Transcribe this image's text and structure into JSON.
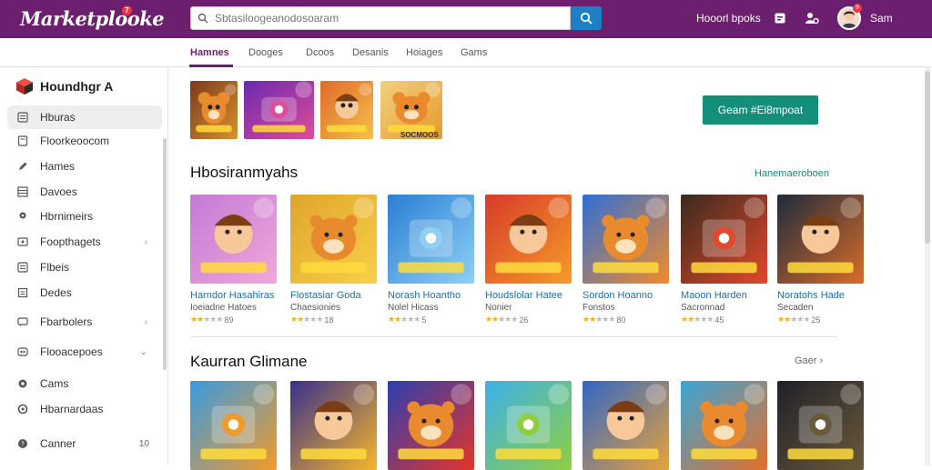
{
  "header": {
    "logo": "Marketplooke",
    "logo_badge": "7",
    "search_placeholder": "Sbtasiloogeanodosoaram",
    "link": "Hooorl bpoks",
    "avatar_badge": "9",
    "user_name": "Sam"
  },
  "tabs": [
    {
      "label": "Hamnes",
      "active": true
    },
    {
      "label": "Dooges"
    },
    {
      "label": "Dcoos"
    },
    {
      "label": "Desanis"
    },
    {
      "label": "Hoiages"
    },
    {
      "label": "Gams"
    }
  ],
  "sidebar": {
    "heading": "Houndhgr A",
    "items": [
      {
        "label": "Hburas",
        "icon": "list-icon",
        "active": true
      },
      {
        "label": "Floorkeoocom",
        "icon": "document-icon"
      },
      {
        "label": "Hames",
        "icon": "pencil-icon"
      },
      {
        "label": "Davoes",
        "icon": "grid-icon"
      },
      {
        "label": "Hbrnimeirs",
        "icon": "pin-icon"
      },
      {
        "label": "Foopthagets",
        "icon": "box-icon",
        "chevron": "›"
      },
      {
        "label": "Flbeis",
        "icon": "list-icon"
      },
      {
        "label": "Dedes",
        "icon": "folder-icon"
      },
      {
        "label": "Fbarbolers",
        "icon": "chat-icon",
        "chevron": "›"
      },
      {
        "label": "Flooacepoes",
        "icon": "group-icon",
        "chevron": "⌄"
      },
      {
        "label": "Cams",
        "icon": "settings-icon"
      },
      {
        "label": "Hbarnardaas",
        "icon": "gear-icon"
      },
      {
        "label": "Canner",
        "icon": "help-icon",
        "count": "10"
      }
    ]
  },
  "promo": {
    "label": "SOCMOOS",
    "cta": "Geam #Ei8mpoat"
  },
  "section1": {
    "title": "Hbosiranmyahs",
    "link": "Hanemaeroboen",
    "cards": [
      {
        "title": "Harndor Hasahiras",
        "sub": "Ioeiadne Hatoes",
        "rating": 2,
        "count": "89",
        "palette": [
          "#c27ad6",
          "#f2a7d8"
        ]
      },
      {
        "title": "Flostasiar Goda",
        "sub": "Chaesionies",
        "rating": 2,
        "count": "18",
        "palette": [
          "#e0a42b",
          "#f7d04a"
        ]
      },
      {
        "title": "Norash Hoantho",
        "sub": "Nolel Hicass",
        "rating": 2,
        "count": "5",
        "palette": [
          "#2a7fd4",
          "#8fd0f5"
        ]
      },
      {
        "title": "Houdslolar Hatee",
        "sub": "Nonier",
        "rating": 2,
        "count": "26",
        "palette": [
          "#d83a2a",
          "#f59b2a"
        ]
      },
      {
        "title": "Sordon Hoanno",
        "sub": "Fonstos",
        "rating": 2,
        "count": "80",
        "palette": [
          "#2e6fd8",
          "#f28a2a"
        ]
      },
      {
        "title": "Maoon Harden",
        "sub": "Sacronnad",
        "rating": 2,
        "count": "45",
        "palette": [
          "#3a2a1e",
          "#e2482c"
        ]
      },
      {
        "title": "Noratohs Hade",
        "sub": "Secaden",
        "rating": 2,
        "count": "25",
        "palette": [
          "#1f2b3c",
          "#d96c2a"
        ]
      }
    ]
  },
  "section2": {
    "title": "Kaurran Glimane",
    "link": "Gaer ›",
    "cards": [
      {
        "title": "",
        "palette": [
          "#3a9ae0",
          "#f19a2c"
        ]
      },
      {
        "title": "",
        "palette": [
          "#3a2f8a",
          "#f5b72a"
        ]
      },
      {
        "title": "",
        "palette": [
          "#2b3fb0",
          "#e5342a"
        ]
      },
      {
        "title": "",
        "palette": [
          "#3db0e8",
          "#8ecf42"
        ]
      },
      {
        "title": "",
        "palette": [
          "#3266c6",
          "#e6a23a"
        ]
      },
      {
        "title": "",
        "palette": [
          "#3aa6d8",
          "#e36f2a"
        ]
      },
      {
        "title": "",
        "palette": [
          "#20202a",
          "#6b5a3a"
        ]
      }
    ]
  },
  "promo_tiles": [
    {
      "palette": [
        "#7a3b1d",
        "#d8902e"
      ]
    },
    {
      "palette": [
        "#6a2ab0",
        "#e04b9a"
      ]
    },
    {
      "palette": [
        "#e06a2a",
        "#f4c04a"
      ]
    },
    {
      "palette": [
        "#f3d082",
        "#e49a2a"
      ]
    }
  ]
}
